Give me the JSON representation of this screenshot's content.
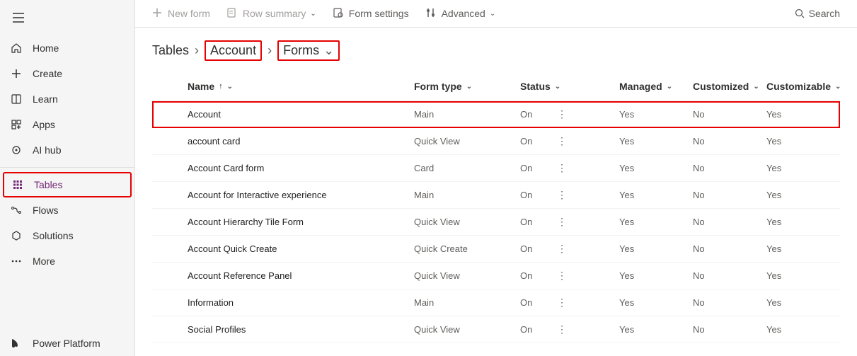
{
  "sidebar": {
    "items": [
      {
        "icon": "home",
        "label": "Home"
      },
      {
        "icon": "plus",
        "label": "Create"
      },
      {
        "icon": "book",
        "label": "Learn"
      },
      {
        "icon": "apps",
        "label": "Apps"
      },
      {
        "icon": "aihub",
        "label": "AI hub"
      },
      {
        "icon": "tables",
        "label": "Tables",
        "active": true,
        "highlight": true
      },
      {
        "icon": "flows",
        "label": "Flows"
      },
      {
        "icon": "solutions",
        "label": "Solutions"
      },
      {
        "icon": "more",
        "label": "More"
      }
    ],
    "footer": {
      "icon": "pp",
      "label": "Power Platform"
    }
  },
  "toolbar": {
    "new_form": "New form",
    "row_summary": "Row summary",
    "form_settings": "Form settings",
    "advanced": "Advanced",
    "search_placeholder": "Search"
  },
  "breadcrumb": {
    "root": "Tables",
    "item1": "Account",
    "item2": "Forms"
  },
  "columns": {
    "name": "Name",
    "form_type": "Form type",
    "status": "Status",
    "managed": "Managed",
    "customized": "Customized",
    "customizable": "Customizable"
  },
  "rows": [
    {
      "name": "Account",
      "form_type": "Main",
      "status": "On",
      "managed": "Yes",
      "customized": "No",
      "customizable": "Yes",
      "highlight": true
    },
    {
      "name": "account card",
      "form_type": "Quick View",
      "status": "On",
      "managed": "Yes",
      "customized": "No",
      "customizable": "Yes"
    },
    {
      "name": "Account Card form",
      "form_type": "Card",
      "status": "On",
      "managed": "Yes",
      "customized": "No",
      "customizable": "Yes"
    },
    {
      "name": "Account for Interactive experience",
      "form_type": "Main",
      "status": "On",
      "managed": "Yes",
      "customized": "No",
      "customizable": "Yes"
    },
    {
      "name": "Account Hierarchy Tile Form",
      "form_type": "Quick View",
      "status": "On",
      "managed": "Yes",
      "customized": "No",
      "customizable": "Yes"
    },
    {
      "name": "Account Quick Create",
      "form_type": "Quick Create",
      "status": "On",
      "managed": "Yes",
      "customized": "No",
      "customizable": "Yes"
    },
    {
      "name": "Account Reference Panel",
      "form_type": "Quick View",
      "status": "On",
      "managed": "Yes",
      "customized": "No",
      "customizable": "Yes"
    },
    {
      "name": "Information",
      "form_type": "Main",
      "status": "On",
      "managed": "Yes",
      "customized": "No",
      "customizable": "Yes"
    },
    {
      "name": "Social Profiles",
      "form_type": "Quick View",
      "status": "On",
      "managed": "Yes",
      "customized": "No",
      "customizable": "Yes"
    }
  ]
}
